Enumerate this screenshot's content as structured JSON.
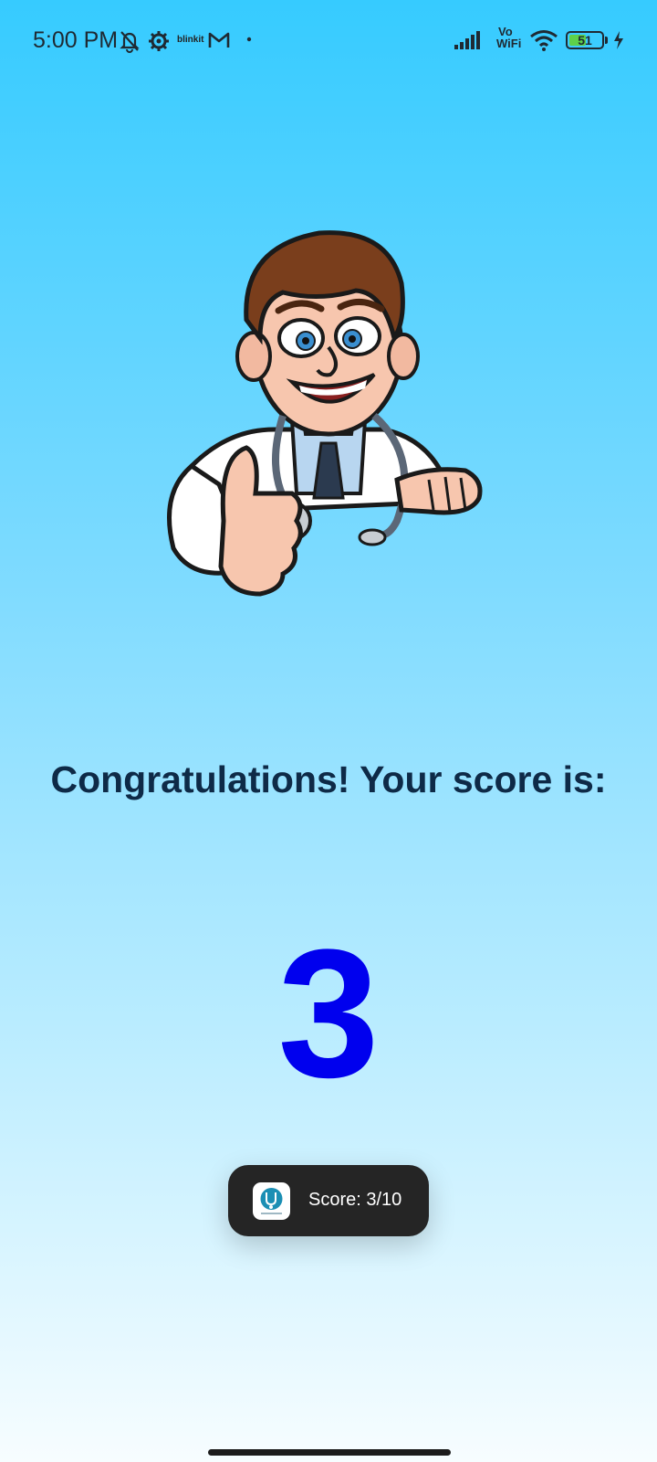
{
  "status_bar": {
    "time": "5:00 PM",
    "icons": [
      "notifications-muted-icon",
      "settings-icon",
      "blinkit-icon",
      "gmail-icon",
      "dot-icon",
      "signal-icon",
      "vowifi-icon",
      "wifi-icon",
      "battery-icon",
      "charging-icon"
    ],
    "blinkit_label": "blinkit",
    "vowifi_label_top": "Vo",
    "vowifi_label_bottom": "WiFi",
    "battery_level": "51"
  },
  "main": {
    "illustration": "doctor-thumbs-up-illustration",
    "heading": "Congratulations! Your score is:",
    "score": "3"
  },
  "toast": {
    "app_icon": "stethoscope-app-icon",
    "message": "Score: 3/10"
  },
  "colors": {
    "background_top": "#36cbff",
    "background_bottom": "#f7fdff",
    "heading": "#0e2a47",
    "score": "#0000ee",
    "toast_bg": "#252525"
  }
}
